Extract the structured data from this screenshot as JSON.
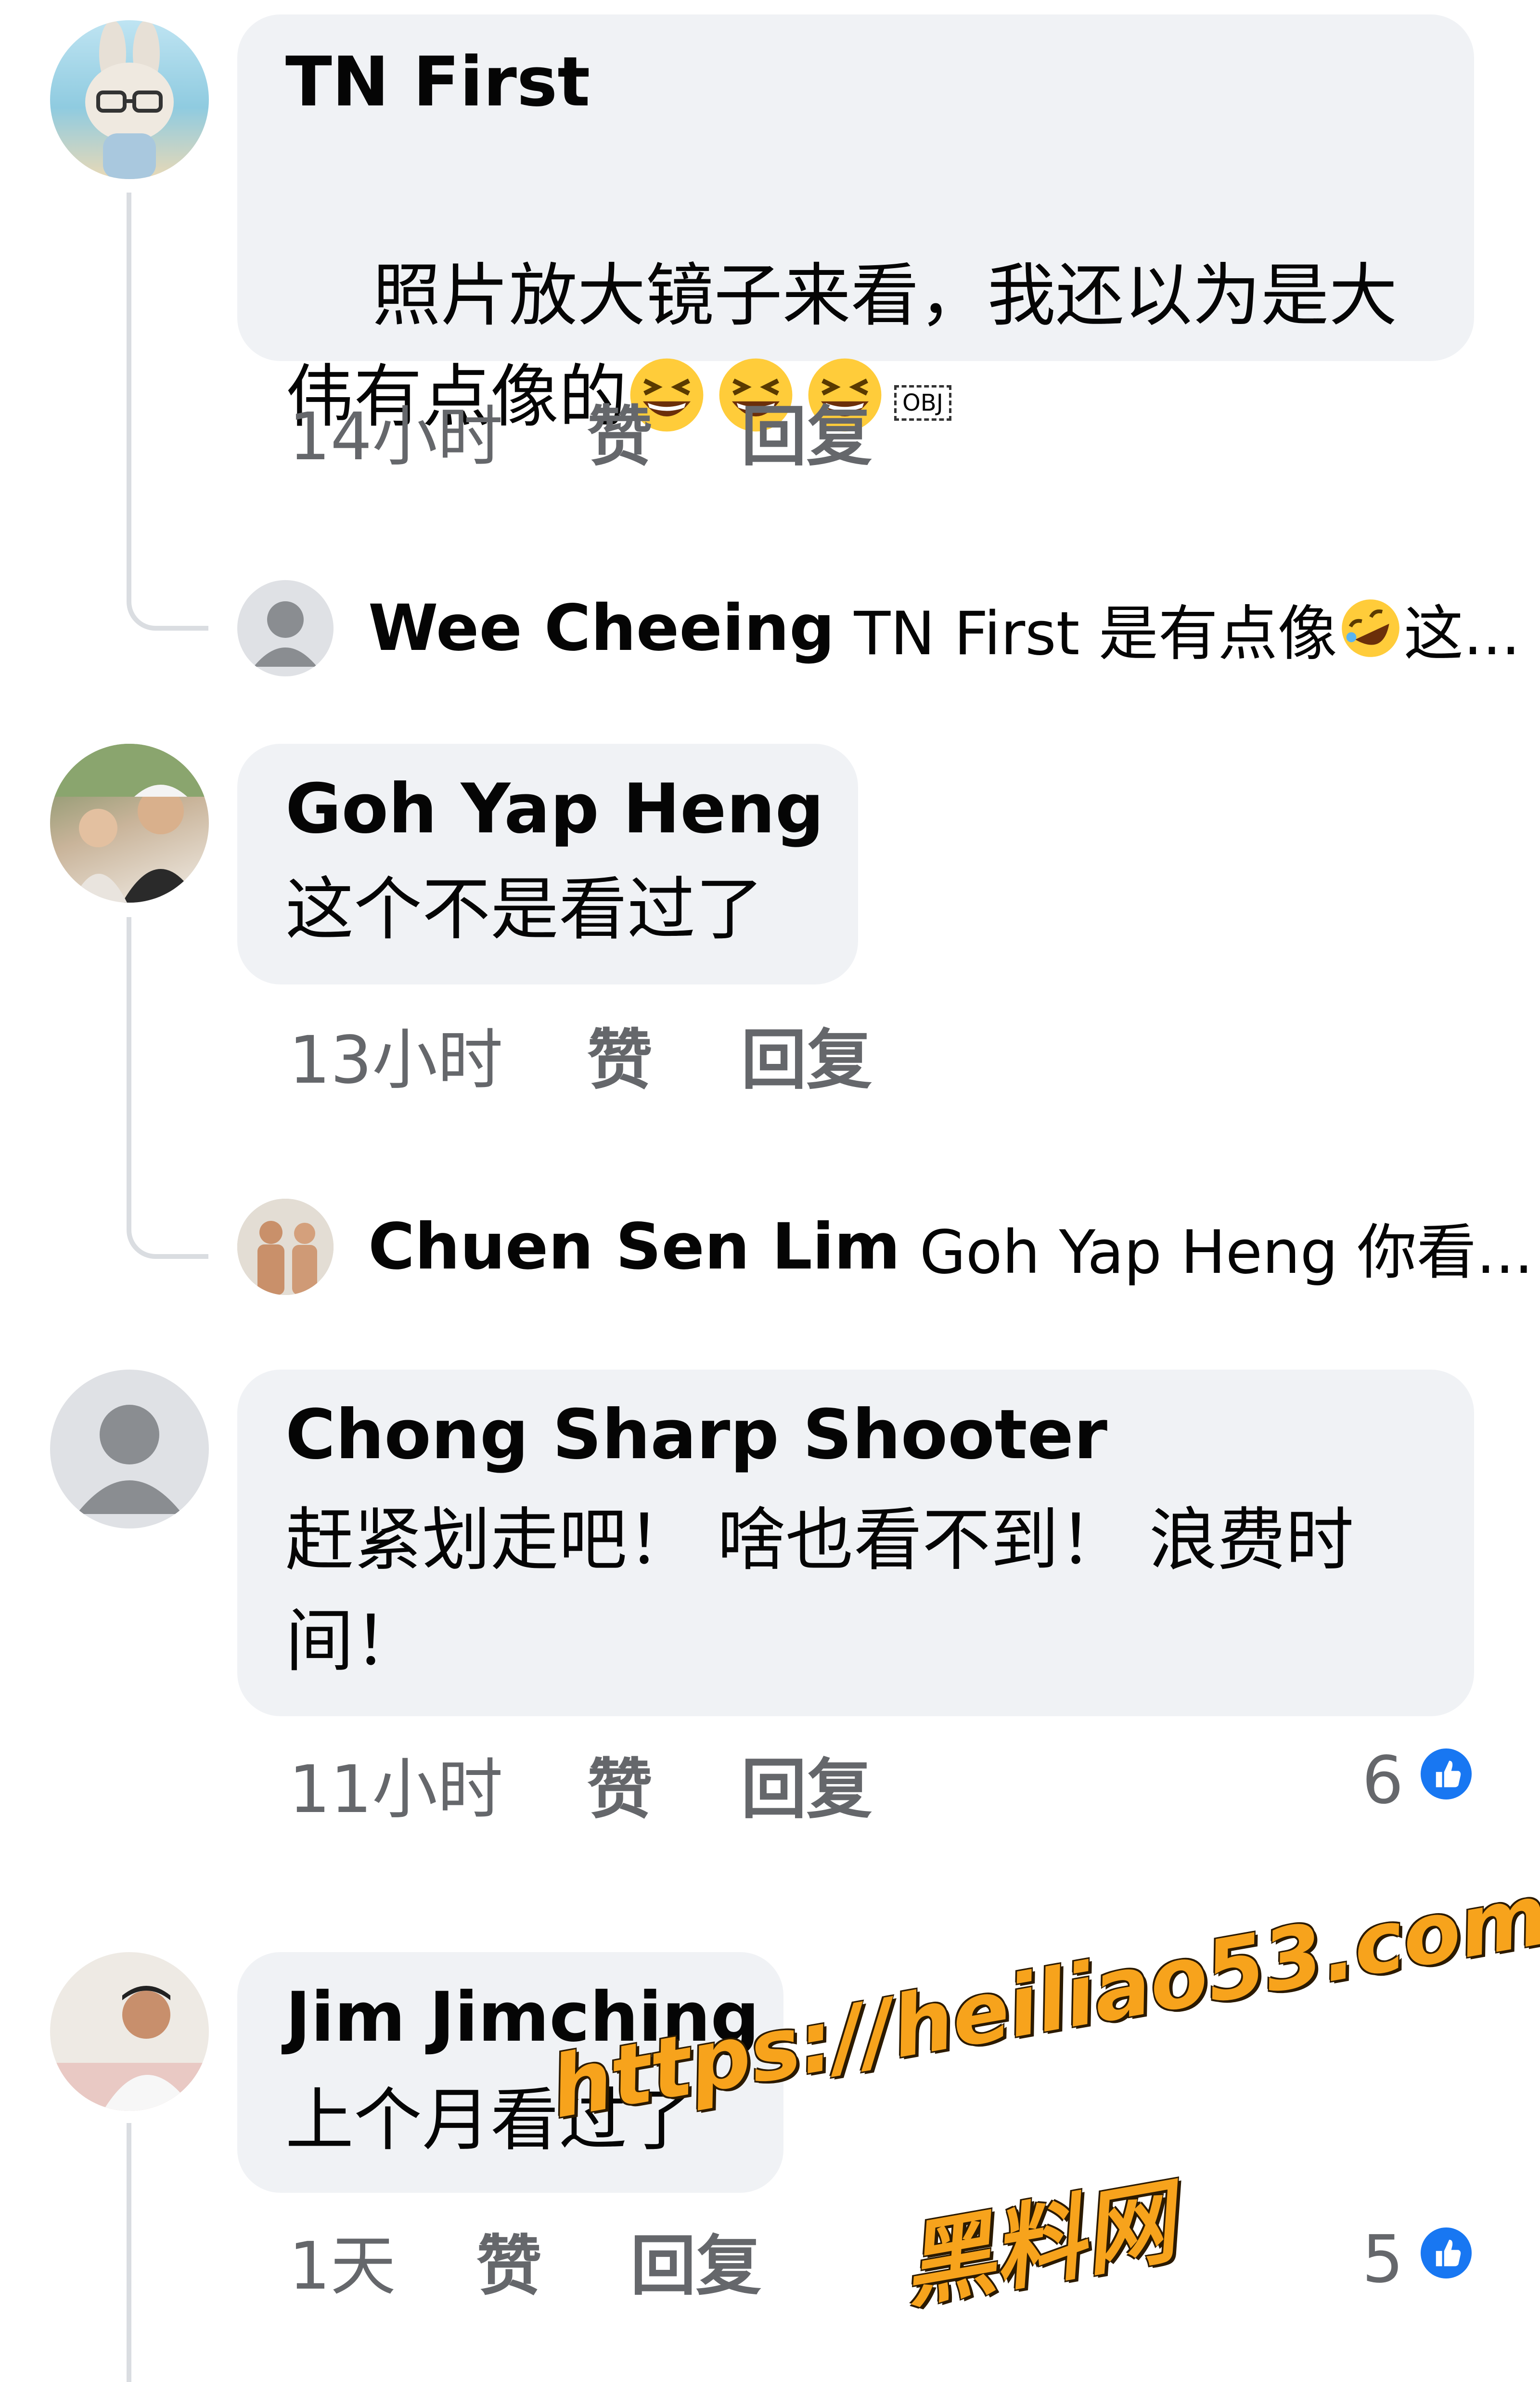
{
  "comments": [
    {
      "author": "TN First",
      "text": "照片放大镜子来看，我还以为是大伟有点像的",
      "emojis": [
        "grinning-squinting-emoji",
        "grinning-squinting-emoji",
        "grinning-squinting-emoji"
      ],
      "obj_placeholder": "OBJ",
      "time": "14小时",
      "like_label": "赞",
      "reply_label": "回复",
      "reply_preview": {
        "author": "Wee Cheeing",
        "text_before": "TN First 是有点像",
        "emoji": "rolling-on-floor-laughing-emoji",
        "text_after": "这..."
      }
    },
    {
      "author": "Goh Yap Heng",
      "text": "这个不是看过了",
      "time": "13小时",
      "like_label": "赞",
      "reply_label": "回复",
      "reply_preview": {
        "author": "Chuen Sen Lim",
        "text": "Goh Yap Heng 你看..."
      }
    },
    {
      "author": "Chong Sharp Shooter",
      "text": "赶紧划走吧！ 啥也看不到！ 浪费时间！",
      "time": "11小时",
      "like_label": "赞",
      "reply_label": "回复",
      "like_count": "6"
    },
    {
      "author": "Jim Jimching",
      "text": "上个月看过了",
      "time": "1天",
      "like_label": "赞",
      "reply_label": "回复",
      "like_count": "5"
    }
  ],
  "watermark": {
    "url": "https://heiliao53.com",
    "name": "黑料网"
  },
  "colors": {
    "bubble": "#f0f2f5",
    "meta_text": "#65676b",
    "like_blue": "#1877f2",
    "watermark": "#f7a31c"
  }
}
